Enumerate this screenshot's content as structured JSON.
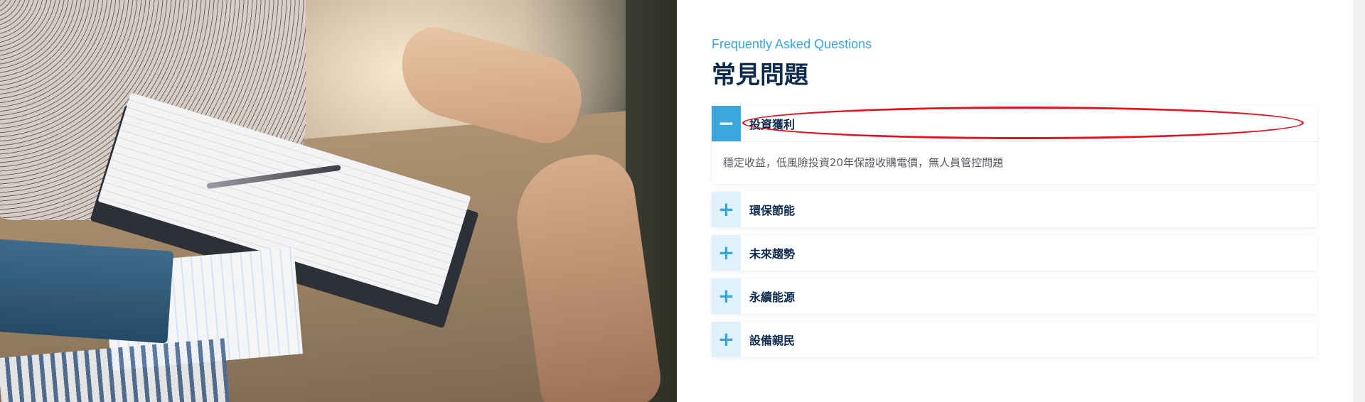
{
  "faq": {
    "subtitle": "Frequently Asked Questions",
    "title": "常見問題",
    "items": [
      {
        "question": "投資獲利",
        "answer": "穩定收益，低風險投資20年保證收購電價，無人員管控問題",
        "open": true,
        "toggle": "−"
      },
      {
        "question": "環保節能",
        "open": false,
        "toggle": "+"
      },
      {
        "question": "未來趨勢",
        "open": false,
        "toggle": "+"
      },
      {
        "question": "永續能源",
        "open": false,
        "toggle": "+"
      },
      {
        "question": "設備親民",
        "open": false,
        "toggle": "+"
      }
    ]
  },
  "colors": {
    "accent": "#3ba6dc",
    "accent_light": "#dff1fa",
    "title": "#0d2c4d",
    "highlight": "#e2131f"
  },
  "icons": {
    "collapse": "minus-icon",
    "expand": "plus-icon"
  }
}
